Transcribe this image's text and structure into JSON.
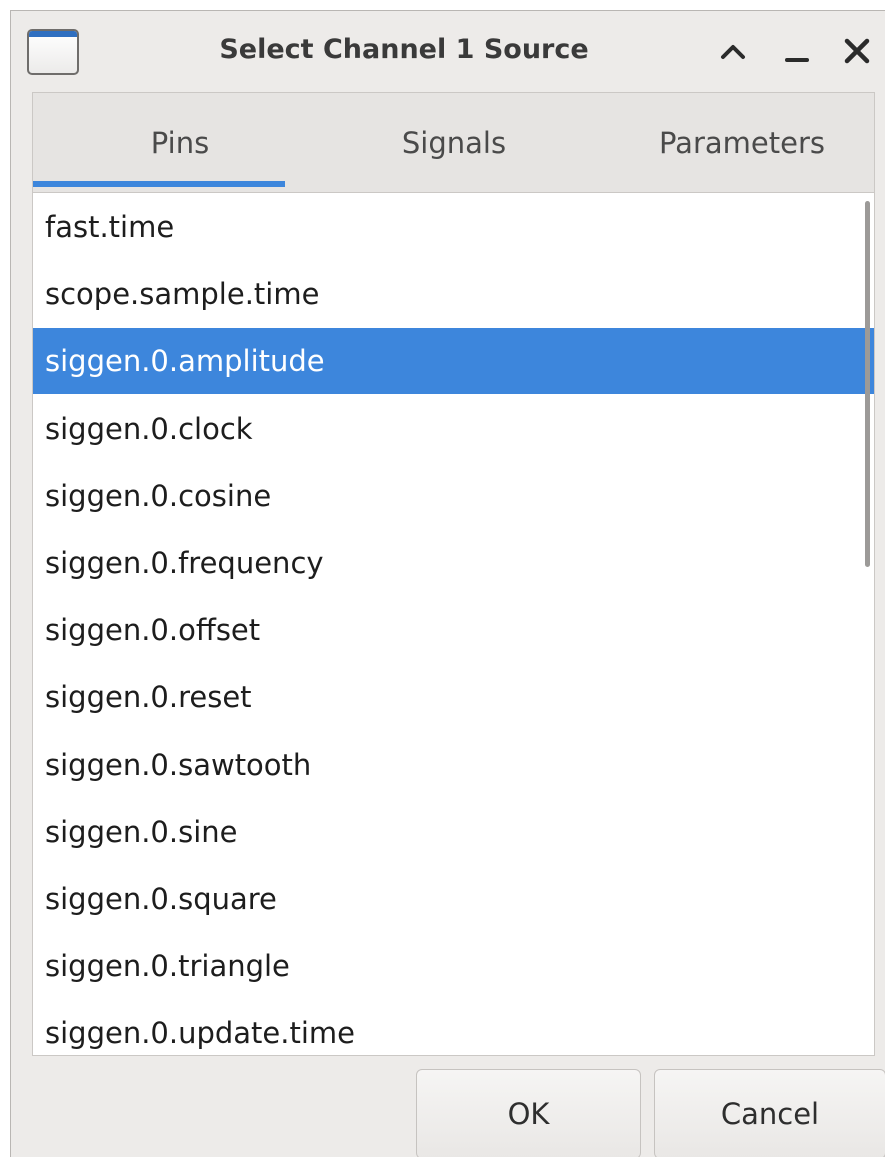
{
  "window": {
    "title": "Select Channel 1 Source",
    "controls": [
      "shade-icon",
      "minimize-icon",
      "close-icon"
    ]
  },
  "tabs": [
    {
      "label": "Pins",
      "active": true
    },
    {
      "label": "Signals",
      "active": false
    },
    {
      "label": "Parameters",
      "active": false
    }
  ],
  "list": {
    "items": [
      "fast.time",
      "scope.sample.time",
      "siggen.0.amplitude",
      "siggen.0.clock",
      "siggen.0.cosine",
      "siggen.0.frequency",
      "siggen.0.offset",
      "siggen.0.reset",
      "siggen.0.sawtooth",
      "siggen.0.sine",
      "siggen.0.square",
      "siggen.0.triangle",
      "siggen.0.update.time"
    ],
    "selected": "siggen.0.amplitude"
  },
  "buttons": {
    "ok": "OK",
    "cancel": "Cancel"
  },
  "colors": {
    "accent": "#3d86dc",
    "window_bg": "#edebe9",
    "list_bg": "#ffffff"
  }
}
